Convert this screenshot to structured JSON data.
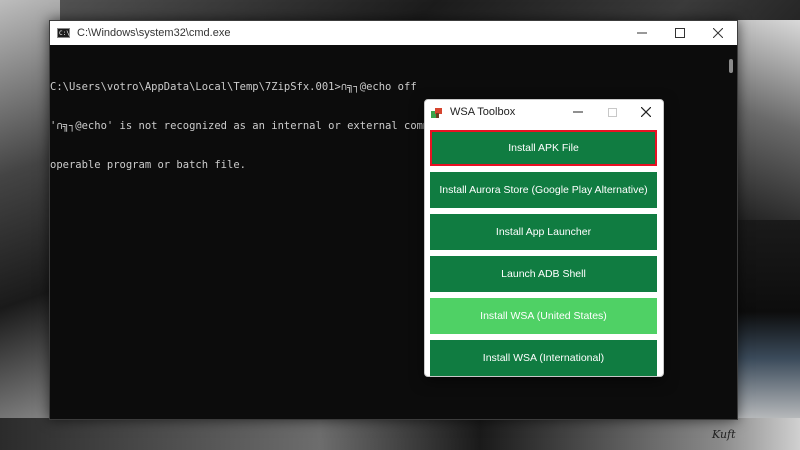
{
  "cmd_window": {
    "title": "C:\\Windows\\system32\\cmd.exe",
    "lines": [
      "C:\\Users\\votro\\AppData\\Local\\Temp\\7ZipSfx.001>∩╗┐@echo off",
      "'∩╗┐@echo' is not recognized as an internal or external command,",
      "operable program or batch file."
    ]
  },
  "toolbox": {
    "title": "WSA Toolbox",
    "buttons": [
      {
        "label": "Install APK File"
      },
      {
        "label": "Install Aurora Store (Google Play Alternative)"
      },
      {
        "label": "Install App Launcher"
      },
      {
        "label": "Launch ADB Shell"
      },
      {
        "label": "Install WSA (United States)"
      },
      {
        "label": "Install WSA (International)"
      }
    ],
    "colors": {
      "button": "#107c41",
      "button_hover": "#4fd165",
      "focus_border": "#e81123"
    }
  },
  "wallpaper": {
    "signature": "Kuft"
  }
}
